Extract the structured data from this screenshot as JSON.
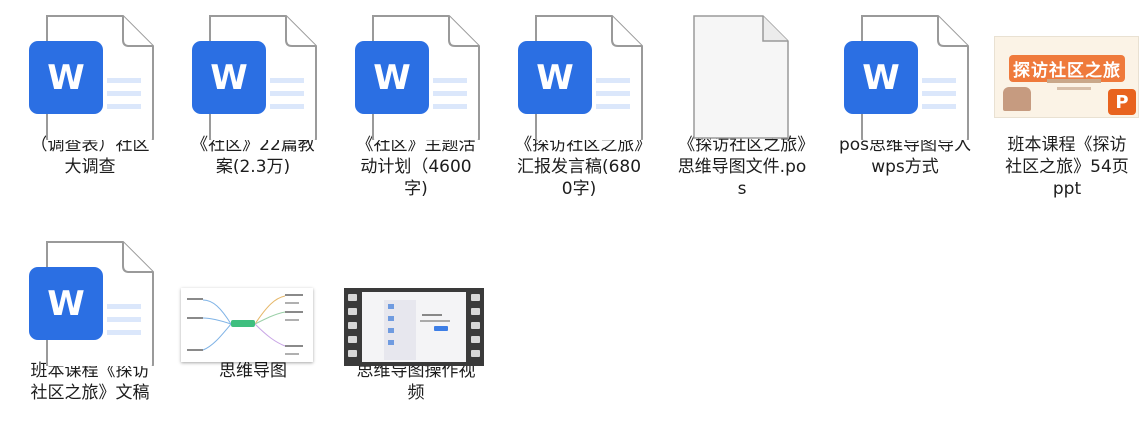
{
  "files": [
    {
      "name": "（调查表）社区大调查",
      "type": "word-icon"
    },
    {
      "name": "《社区》22篇教案(2.3万)",
      "type": "word-icon"
    },
    {
      "name": "《社区》主题活动计划（4600字)",
      "type": "word-icon"
    },
    {
      "name": "《探访社区之旅》汇报发言稿(6800字)",
      "type": "word-icon"
    },
    {
      "name": "《探访社区之旅》思维导图文件.pos",
      "type": "blank-file-icon"
    },
    {
      "name": "pos思维导图导入wps方式",
      "type": "word-icon"
    },
    {
      "name": "班本课程《探访社区之旅》54页ppt",
      "type": "ppt-thumbnail",
      "thumb_title": "探访社区之旅"
    },
    {
      "name": "班本课程《探访社区之旅》文稿",
      "type": "word-icon"
    },
    {
      "name": "思维导图",
      "type": "mindmap-thumbnail"
    },
    {
      "name": "思维导图操作视频",
      "type": "video-thumbnail"
    }
  ],
  "colors": {
    "word_blue": "#2b6fe3",
    "ppt_orange": "#e8631e"
  }
}
